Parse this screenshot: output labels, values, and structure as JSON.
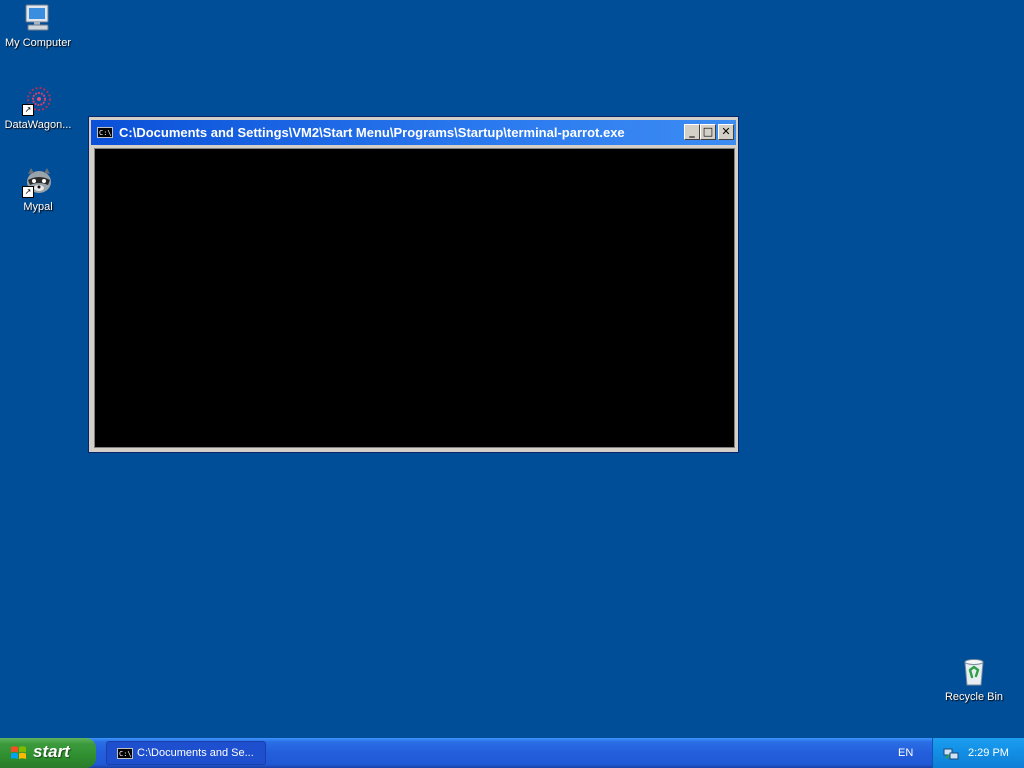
{
  "desktop": {
    "background_color": "#004e98",
    "icons": [
      {
        "label": "My Computer",
        "icon": "computer-icon"
      },
      {
        "label": "DataWagon...",
        "icon": "datawagon-icon"
      },
      {
        "label": "Mypal",
        "icon": "raccoon-icon"
      },
      {
        "label": "Recycle Bin",
        "icon": "recycle-bin-icon"
      }
    ]
  },
  "console_window": {
    "title": "C:\\Documents and Settings\\VM2\\Start Menu\\Programs\\Startup\\terminal-parrot.exe",
    "icon_text": "C:\\",
    "minimize_label": "_",
    "maximize_label": "□",
    "close_label": "✕"
  },
  "taskbar": {
    "start_label": "start",
    "task_items": [
      {
        "label": "C:\\Documents and Se...",
        "icon_text": "C:\\"
      }
    ],
    "language": "EN",
    "clock": "2:29 PM"
  }
}
